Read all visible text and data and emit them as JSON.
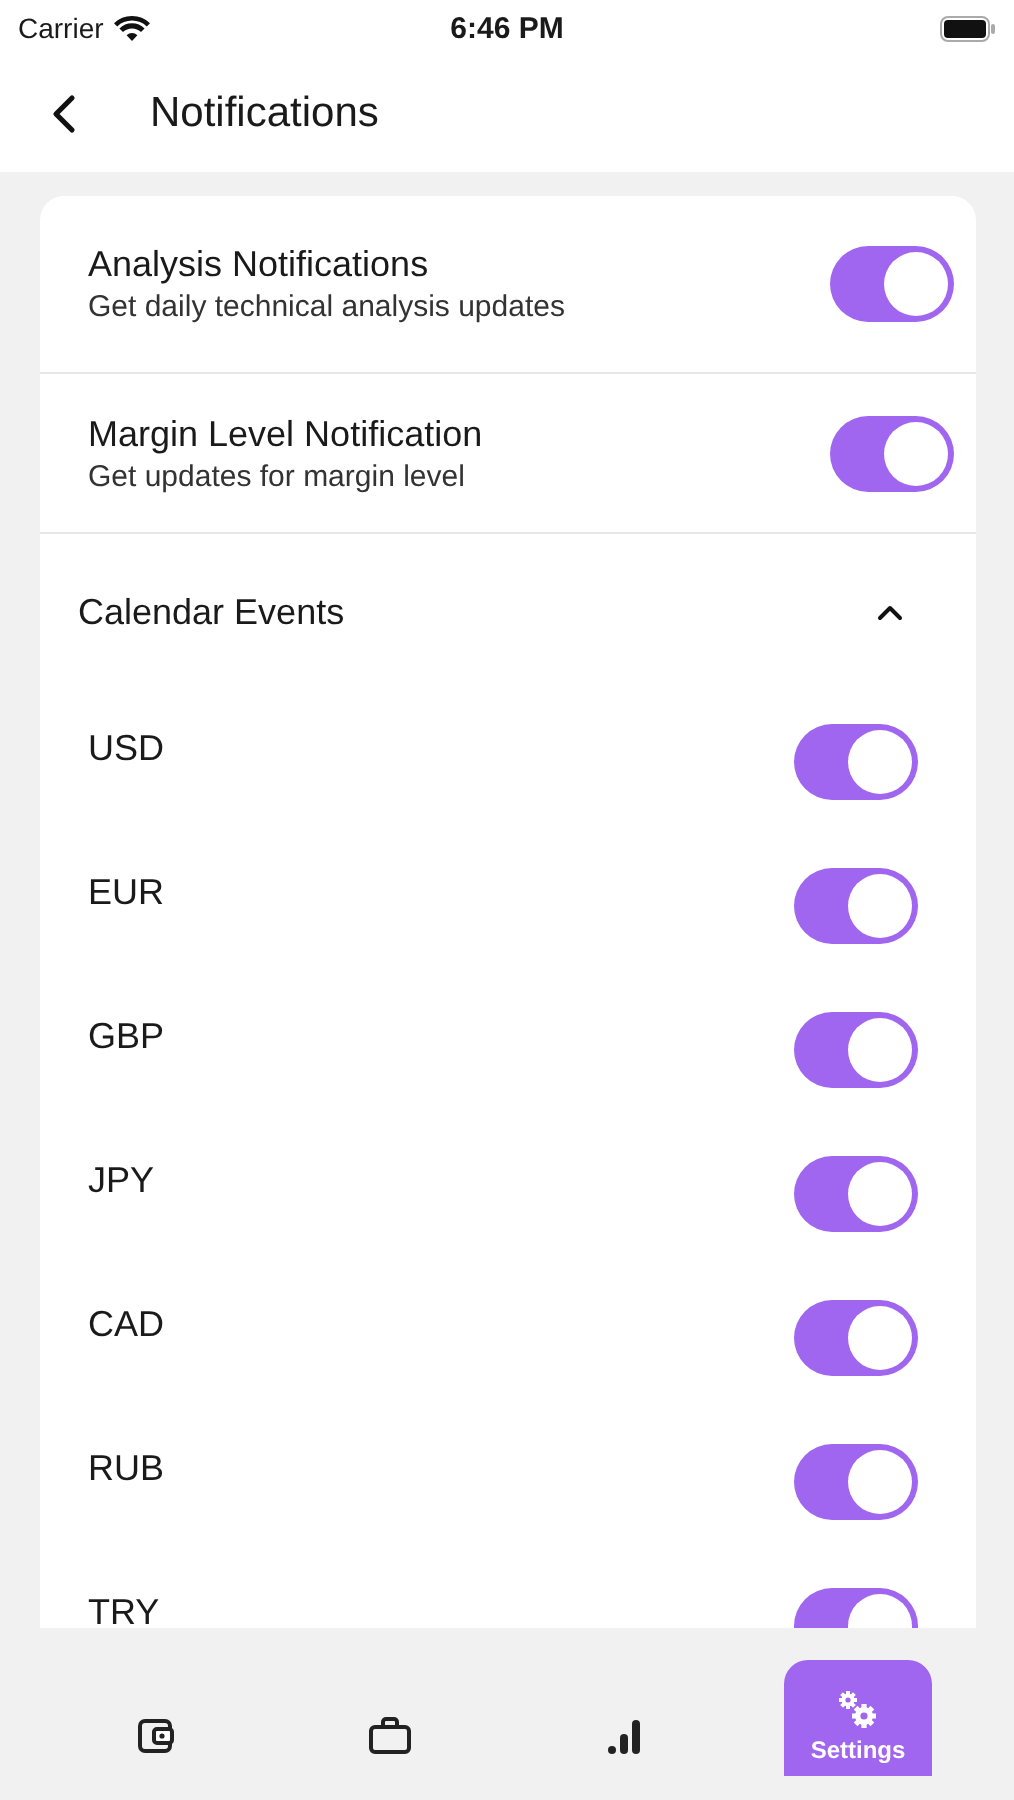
{
  "status_bar": {
    "carrier": "Carrier",
    "time": "6:46 PM"
  },
  "header": {
    "title": "Notifications"
  },
  "settings": [
    {
      "title": "Analysis Notifications",
      "subtitle": "Get daily technical analysis updates",
      "on": true
    },
    {
      "title": "Margin Level Notification",
      "subtitle": "Get updates for margin level",
      "on": true
    }
  ],
  "calendar": {
    "title": "Calendar Events",
    "expanded": true,
    "items": [
      {
        "label": "USD",
        "on": true
      },
      {
        "label": "EUR",
        "on": true
      },
      {
        "label": "GBP",
        "on": true
      },
      {
        "label": "JPY",
        "on": true
      },
      {
        "label": "CAD",
        "on": true
      },
      {
        "label": "RUB",
        "on": true
      },
      {
        "label": "TRY",
        "on": true
      }
    ]
  },
  "tab_bar": [
    {
      "kind": "wallet",
      "selected": false
    },
    {
      "kind": "briefcase",
      "selected": false
    },
    {
      "kind": "chart",
      "selected": false
    },
    {
      "kind": "settings",
      "label": "Settings",
      "selected": true
    }
  ]
}
